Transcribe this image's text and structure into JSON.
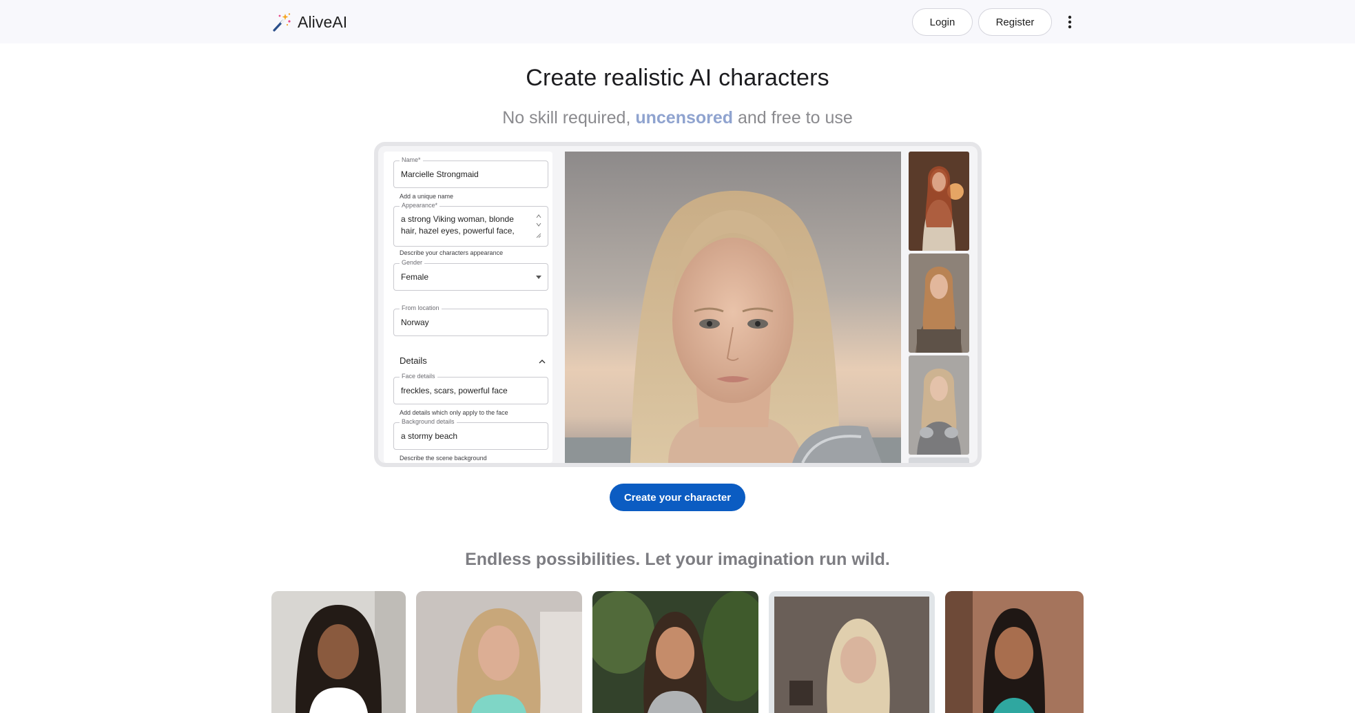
{
  "header": {
    "brand_name": "AliveAI",
    "login_label": "Login",
    "register_label": "Register"
  },
  "hero": {
    "title": "Create realistic AI characters",
    "subtitle_before": "No skill required, ",
    "subtitle_accent": "uncensored",
    "subtitle_after": " and free to use"
  },
  "form": {
    "name_label": "Name*",
    "name_value": "Marcielle Strongmaid",
    "name_helper": "Add a unique name",
    "appearance_label": "Appearance*",
    "appearance_value": "a strong Viking woman, blonde hair, hazel eyes, powerful face,",
    "appearance_helper": "Describe your characters appearance",
    "gender_label": "Gender",
    "gender_value": "Female",
    "location_label": "From location",
    "location_value": "Norway",
    "details_heading": "Details",
    "face_label": "Face details",
    "face_value": "freckles, scars, powerful face",
    "face_helper": "Add details which only apply to the face",
    "background_label": "Background details",
    "background_value": "a stormy beach",
    "background_helper": "Describe the scene background"
  },
  "cta": {
    "label": "Create your character"
  },
  "gallery": {
    "title": "Endless possibilities. Let your imagination run wild."
  },
  "colors": {
    "accent": "#8fa3cf",
    "primary_button": "#0b5cc2",
    "header_bg": "#f8f8fc"
  },
  "icons": {
    "brand": "magic-wand-icon",
    "menu": "more-vertical-icon",
    "dropdown": "caret-down-icon",
    "collapse": "chevron-up-icon"
  }
}
